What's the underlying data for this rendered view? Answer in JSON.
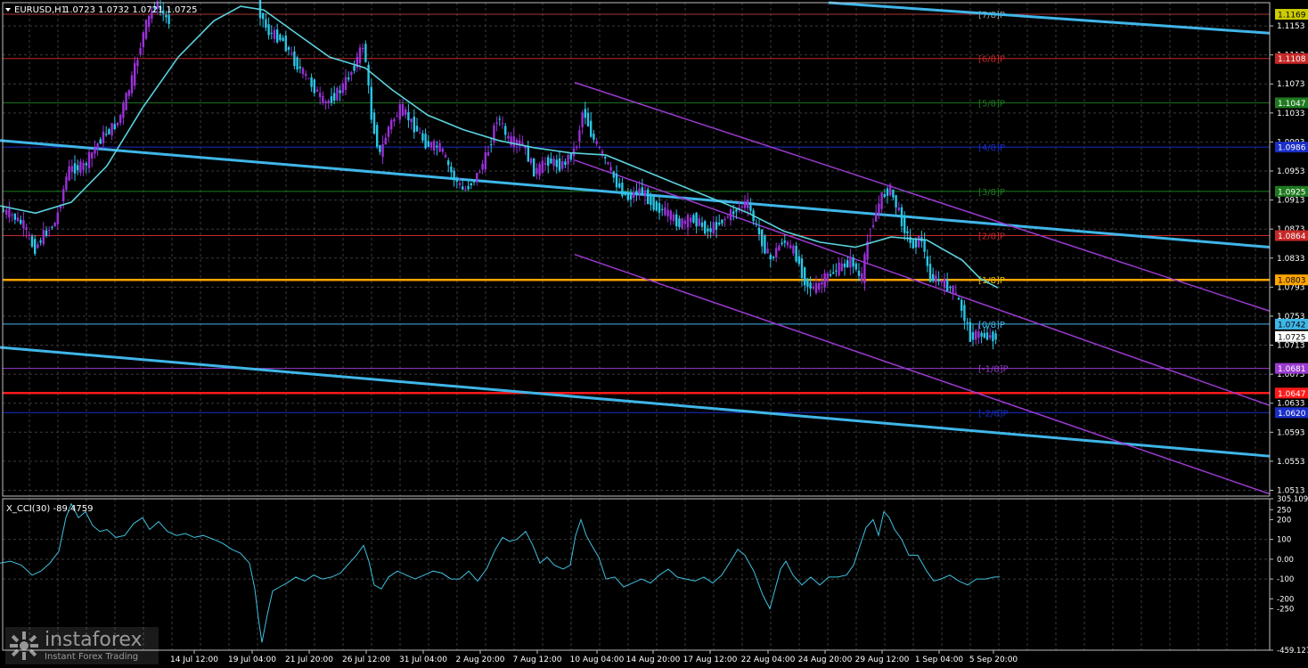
{
  "colors": {
    "background": "#000000",
    "frame": "#c0c0c0",
    "grid": "#3a3a3a",
    "text": "#ffffff",
    "bull_candle": "#9b30d9",
    "bear_candle": "#29c6e6",
    "moving_average": "#5ad2de",
    "trend_line": "#3fb6e8",
    "channel": "#9a3ad0",
    "cci_line": "#3fc1e0"
  },
  "header": {
    "symbol": "EURUSD,H1",
    "ohlc": "1.0723 1.0732 1.0721 1.0725"
  },
  "subwindow": {
    "label": "X_CCI(30) -89.4759"
  },
  "watermark": {
    "brand": "instaforex",
    "tagline": "Instant Forex Trading"
  },
  "chart_data": [
    {
      "type": "candlestick",
      "symbol": "EURUSD",
      "timeframe": "H1",
      "ylim": [
        1.0505,
        1.1185
      ],
      "y_tick_labels": [
        "1.1153",
        "1.1113",
        "1.1073",
        "1.1033",
        "1.0993",
        "1.0953",
        "1.0913",
        "1.0873",
        "1.0833",
        "1.0793",
        "1.0753",
        "1.0713",
        "1.0673",
        "1.0633",
        "1.0593",
        "1.0553",
        "1.0513"
      ],
      "x_tick_labels": [
        "14 Jul 12:00",
        "19 Jul 04:00",
        "21 Jul 20:00",
        "26 Jul 12:00",
        "31 Jul 04:00",
        "2 Aug 20:00",
        "7 Aug 12:00",
        "10 Aug 04:00",
        "14 Aug 20:00",
        "17 Aug 12:00",
        "22 Aug 04:00",
        "24 Aug 20:00",
        "29 Aug 12:00",
        "1 Sep 04:00",
        "5 Sep 20:00"
      ],
      "price_path": [
        [
          0,
          1.09
        ],
        [
          14,
          1.0893
        ],
        [
          28,
          1.0878
        ],
        [
          40,
          1.0845
        ],
        [
          52,
          1.0868
        ],
        [
          64,
          1.0882
        ],
        [
          78,
          1.0955
        ],
        [
          96,
          1.096
        ],
        [
          116,
          1.1
        ],
        [
          134,
          1.102
        ],
        [
          150,
          1.108
        ],
        [
          164,
          1.115
        ],
        [
          176,
          1.1185
        ],
        [
          190,
          1.116
        ],
        [
          290,
          1.1183
        ],
        [
          302,
          1.1145
        ],
        [
          318,
          1.1135
        ],
        [
          334,
          1.11
        ],
        [
          350,
          1.1075
        ],
        [
          366,
          1.1045
        ],
        [
          384,
          1.1065
        ],
        [
          398,
          1.1095
        ],
        [
          410,
          1.113
        ],
        [
          418,
          1.103
        ],
        [
          428,
          1.0975
        ],
        [
          438,
          1.1015
        ],
        [
          452,
          1.104
        ],
        [
          466,
          1.1015
        ],
        [
          480,
          1.099
        ],
        [
          496,
          1.0985
        ],
        [
          510,
          1.0945
        ],
        [
          522,
          1.0925
        ],
        [
          536,
          1.0945
        ],
        [
          548,
          1.0975
        ],
        [
          560,
          1.103
        ],
        [
          572,
          1.0995
        ],
        [
          588,
          1.099
        ],
        [
          602,
          1.095
        ],
        [
          616,
          1.0968
        ],
        [
          632,
          1.096
        ],
        [
          648,
          1.0985
        ],
        [
          656,
          1.104
        ],
        [
          666,
          1.1
        ],
        [
          680,
          1.097
        ],
        [
          694,
          1.0935
        ],
        [
          706,
          1.0915
        ],
        [
          720,
          1.0928
        ],
        [
          736,
          1.0905
        ],
        [
          750,
          1.0895
        ],
        [
          764,
          1.088
        ],
        [
          780,
          1.0888
        ],
        [
          796,
          1.087
        ],
        [
          812,
          1.0885
        ],
        [
          828,
          1.09
        ],
        [
          840,
          1.091
        ],
        [
          852,
          1.087
        ],
        [
          866,
          1.083
        ],
        [
          880,
          1.0858
        ],
        [
          894,
          1.084
        ],
        [
          906,
          1.0798
        ],
        [
          916,
          1.079
        ],
        [
          930,
          1.0808
        ],
        [
          944,
          1.082
        ],
        [
          958,
          1.083
        ],
        [
          968,
          1.08
        ],
        [
          976,
          1.0862
        ],
        [
          990,
          1.0915
        ],
        [
          1000,
          1.093
        ],
        [
          1012,
          1.089
        ],
        [
          1024,
          1.085
        ],
        [
          1036,
          1.086
        ],
        [
          1044,
          1.0808
        ],
        [
          1058,
          1.08
        ],
        [
          1072,
          1.0788
        ],
        [
          1082,
          1.076
        ],
        [
          1090,
          1.0725
        ],
        [
          1100,
          1.0728
        ],
        [
          1110,
          1.0725
        ],
        [
          1120,
          1.0725
        ]
      ],
      "moving_average_path": [
        [
          0,
          1.0905
        ],
        [
          40,
          1.0895
        ],
        [
          80,
          1.091
        ],
        [
          120,
          1.096
        ],
        [
          160,
          1.104
        ],
        [
          200,
          1.111
        ],
        [
          240,
          1.116
        ],
        [
          270,
          1.118
        ],
        [
          296,
          1.1175
        ],
        [
          330,
          1.1145
        ],
        [
          370,
          1.111
        ],
        [
          410,
          1.1095
        ],
        [
          440,
          1.1065
        ],
        [
          480,
          1.103
        ],
        [
          520,
          1.101
        ],
        [
          560,
          1.0995
        ],
        [
          600,
          1.0985
        ],
        [
          640,
          1.0978
        ],
        [
          680,
          1.0975
        ],
        [
          720,
          1.0955
        ],
        [
          760,
          1.0935
        ],
        [
          800,
          1.0915
        ],
        [
          840,
          1.0895
        ],
        [
          880,
          1.087
        ],
        [
          920,
          1.0855
        ],
        [
          960,
          1.0848
        ],
        [
          1000,
          1.0862
        ],
        [
          1040,
          1.0858
        ],
        [
          1080,
          1.083
        ],
        [
          1100,
          1.0805
        ],
        [
          1120,
          1.0792
        ]
      ],
      "horizontal_levels": [
        {
          "label": "[7/8]P",
          "price": 1.1169,
          "color": "#aa3333",
          "label_color": "#a0a0a0",
          "tag_bg": "#cccc00",
          "tag_text": "#000000",
          "tag": "1.1169"
        },
        {
          "label": "[6/8]P",
          "price": 1.1108,
          "color": "#c62828",
          "label_color": "#c62828",
          "tag_bg": "#c62828",
          "tag_text": "#ffffff",
          "tag": "1.1108"
        },
        {
          "label": "[5/8]P",
          "price": 1.1047,
          "color": "#1f7a1f",
          "label_color": "#1f7a1f",
          "tag_bg": "#1f7a1f",
          "tag_text": "#ffffff",
          "tag": "1.1047"
        },
        {
          "label": "[4/8]P",
          "price": 1.0986,
          "color": "#1a2ec8",
          "label_color": "#1a2ec8",
          "tag_bg": "#1a2ec8",
          "tag_text": "#ffffff",
          "tag": "1.0986"
        },
        {
          "label": "[3/8]P",
          "price": 1.0925,
          "color": "#1f7a1f",
          "label_color": "#1f7a1f",
          "tag_bg": "#1f7a1f",
          "tag_text": "#ffffff",
          "tag": "1.0925"
        },
        {
          "label": "[2/8]P",
          "price": 1.0864,
          "color": "#c62828",
          "label_color": "#c62828",
          "tag_bg": "#c62828",
          "tag_text": "#ffffff",
          "tag": "1.0864"
        },
        {
          "label": "[1/8]P",
          "price": 1.0803,
          "color": "#ffa500",
          "label_color": "#e0c000",
          "tag_bg": "#ffa500",
          "tag_text": "#000000",
          "tag": "1.0803",
          "thick": true
        },
        {
          "label": "[0/8]P",
          "price": 1.0742,
          "color": "#3fb6e8",
          "label_color": "#3fb6e8",
          "tag_bg": "#3fb6e8",
          "tag_text": "#000000",
          "tag": "1.0742"
        },
        {
          "label": "[-1/8]P",
          "price": 1.0681,
          "color": "#9a3ad0",
          "label_color": "#9a3ad0",
          "tag_bg": "#9a3ad0",
          "tag_text": "#ffffff",
          "tag": "1.0681"
        },
        {
          "label": "",
          "price": 1.0647,
          "color": "#ff1a1a",
          "label_color": "#ff1a1a",
          "tag_bg": "#ff1a1a",
          "tag_text": "#ffffff",
          "tag": "1.0647",
          "thick": true
        },
        {
          "label": "[-2/8]P",
          "price": 1.062,
          "color": "#1a2ec8",
          "label_color": "#1a2ec8",
          "tag_bg": "#1a2ec8",
          "tag_text": "#ffffff",
          "tag": "1.0620"
        }
      ],
      "current_price": {
        "value": 1.0725,
        "tag_bg": "#ffffff",
        "tag_text": "#000000"
      },
      "trend_lines": [
        {
          "p1": [
            0,
            1.0995
          ],
          "p2": [
            1425,
            1.0848
          ],
          "color": "#3fb6e8"
        },
        {
          "p1": [
            0,
            1.071
          ],
          "p2": [
            1425,
            1.056
          ],
          "color": "#3fb6e8"
        },
        {
          "p1": [
            930,
            1.1185
          ],
          "p2": [
            1425,
            1.1143
          ],
          "color": "#3fb6e8"
        }
      ],
      "channel_lines": [
        {
          "p1": [
            645,
            1.1075
          ],
          "p2": [
            1425,
            1.076
          ],
          "color": "#9a3ad0"
        },
        {
          "p1": [
            645,
            1.0968
          ],
          "p2": [
            1425,
            1.063
          ],
          "color": "#9a3ad0"
        },
        {
          "p1": [
            645,
            1.0838
          ],
          "p2": [
            1425,
            1.0508
          ],
          "color": "#9a3ad0"
        }
      ]
    },
    {
      "type": "line",
      "name": "X_CCI(30)",
      "ylim": [
        -459.1275,
        305.1095
      ],
      "y_tick_labels": [
        "305.1095",
        "250",
        "200",
        "100",
        "0.00",
        "-100",
        "-200",
        "-250",
        "-459.1275"
      ],
      "y_ticks": [
        305.1095,
        250,
        200,
        100,
        0,
        -100,
        -200,
        -250,
        -459.1275
      ],
      "path": [
        [
          0,
          -20
        ],
        [
          12,
          -10
        ],
        [
          24,
          -30
        ],
        [
          36,
          -80
        ],
        [
          46,
          -60
        ],
        [
          56,
          -20
        ],
        [
          66,
          40
        ],
        [
          74,
          210
        ],
        [
          80,
          280
        ],
        [
          88,
          210
        ],
        [
          96,
          240
        ],
        [
          104,
          170
        ],
        [
          112,
          140
        ],
        [
          120,
          150
        ],
        [
          130,
          110
        ],
        [
          140,
          120
        ],
        [
          150,
          180
        ],
        [
          160,
          210
        ],
        [
          168,
          150
        ],
        [
          178,
          190
        ],
        [
          188,
          140
        ],
        [
          198,
          120
        ],
        [
          208,
          130
        ],
        [
          218,
          110
        ],
        [
          228,
          120
        ],
        [
          240,
          100
        ],
        [
          250,
          80
        ],
        [
          260,
          50
        ],
        [
          270,
          30
        ],
        [
          280,
          -20
        ],
        [
          286,
          -150
        ],
        [
          290,
          -300
        ],
        [
          294,
          -420
        ],
        [
          300,
          -280
        ],
        [
          306,
          -160
        ],
        [
          314,
          -140
        ],
        [
          322,
          -120
        ],
        [
          332,
          -90
        ],
        [
          342,
          -110
        ],
        [
          352,
          -80
        ],
        [
          362,
          -100
        ],
        [
          372,
          -90
        ],
        [
          382,
          -70
        ],
        [
          392,
          -20
        ],
        [
          400,
          20
        ],
        [
          408,
          70
        ],
        [
          414,
          -10
        ],
        [
          420,
          -130
        ],
        [
          428,
          -150
        ],
        [
          436,
          -90
        ],
        [
          446,
          -60
        ],
        [
          456,
          -80
        ],
        [
          466,
          -100
        ],
        [
          476,
          -80
        ],
        [
          486,
          -60
        ],
        [
          496,
          -70
        ],
        [
          506,
          -100
        ],
        [
          516,
          -100
        ],
        [
          526,
          -60
        ],
        [
          536,
          -110
        ],
        [
          546,
          -50
        ],
        [
          556,
          50
        ],
        [
          564,
          110
        ],
        [
          572,
          90
        ],
        [
          580,
          100
        ],
        [
          590,
          140
        ],
        [
          598,
          70
        ],
        [
          606,
          -20
        ],
        [
          614,
          10
        ],
        [
          622,
          -30
        ],
        [
          632,
          -50
        ],
        [
          640,
          -30
        ],
        [
          646,
          120
        ],
        [
          652,
          200
        ],
        [
          658,
          120
        ],
        [
          664,
          70
        ],
        [
          672,
          10
        ],
        [
          680,
          -100
        ],
        [
          690,
          -90
        ],
        [
          700,
          -140
        ],
        [
          710,
          -120
        ],
        [
          720,
          -100
        ],
        [
          730,
          -120
        ],
        [
          740,
          -80
        ],
        [
          750,
          -50
        ],
        [
          760,
          -90
        ],
        [
          770,
          -100
        ],
        [
          780,
          -110
        ],
        [
          790,
          -90
        ],
        [
          800,
          -120
        ],
        [
          810,
          -80
        ],
        [
          820,
          -10
        ],
        [
          828,
          50
        ],
        [
          836,
          20
        ],
        [
          846,
          -60
        ],
        [
          856,
          -180
        ],
        [
          864,
          -250
        ],
        [
          870,
          -150
        ],
        [
          876,
          -50
        ],
        [
          882,
          -10
        ],
        [
          890,
          -80
        ],
        [
          900,
          -130
        ],
        [
          910,
          -90
        ],
        [
          920,
          -130
        ],
        [
          930,
          -90
        ],
        [
          940,
          -90
        ],
        [
          950,
          -80
        ],
        [
          958,
          -30
        ],
        [
          966,
          80
        ],
        [
          972,
          160
        ],
        [
          980,
          200
        ],
        [
          986,
          120
        ],
        [
          992,
          240
        ],
        [
          998,
          210
        ],
        [
          1004,
          150
        ],
        [
          1012,
          100
        ],
        [
          1020,
          20
        ],
        [
          1030,
          20
        ],
        [
          1040,
          -60
        ],
        [
          1048,
          -110
        ],
        [
          1056,
          -100
        ],
        [
          1066,
          -80
        ],
        [
          1076,
          -110
        ],
        [
          1086,
          -130
        ],
        [
          1096,
          -100
        ],
        [
          1106,
          -100
        ],
        [
          1116,
          -90
        ],
        [
          1122,
          -89.4759
        ]
      ]
    }
  ]
}
